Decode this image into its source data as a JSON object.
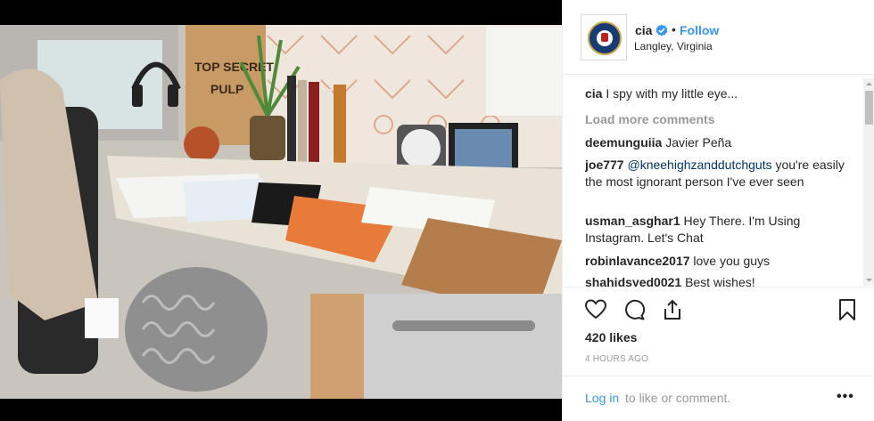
{
  "post": {
    "image_text": {
      "bag_line1": "TOP SECRET",
      "bag_line2": "PULP"
    }
  },
  "header": {
    "username": "cia",
    "separator": "•",
    "follow_label": "Follow",
    "location": "Langley, Virginia"
  },
  "caption": {
    "username": "cia",
    "text": "I spy with my little eye..."
  },
  "load_more_label": "Load more comments",
  "comments": [
    {
      "username": "deemunguiia",
      "text": "Javier Peña"
    },
    {
      "username": "joe777",
      "mention": "@kneehighzanddutchguts",
      "text": "you're easily the most ignorant person I've ever seen"
    },
    {
      "username": "usman_asghar1",
      "text": "Hey There. I'm Using Instagram. Let's Chat"
    },
    {
      "username": "robinlavance2017",
      "text": "love you guys"
    },
    {
      "username": "shahidsyed0021",
      "text": "Best wishes!"
    }
  ],
  "likes": "420 likes",
  "timestamp": "4 HOURS AGO",
  "footer": {
    "login_label": "Log in",
    "login_rest": "to like or comment.",
    "more_label": "•••"
  },
  "colors": {
    "link_blue": "#3897f0",
    "muted": "#999999",
    "text": "#262626",
    "verified": "#3897f0"
  },
  "icons": [
    "heart-icon",
    "comment-icon",
    "share-icon",
    "bookmark-icon",
    "verified-badge-icon",
    "more-options-icon",
    "cia-seal-icon"
  ]
}
